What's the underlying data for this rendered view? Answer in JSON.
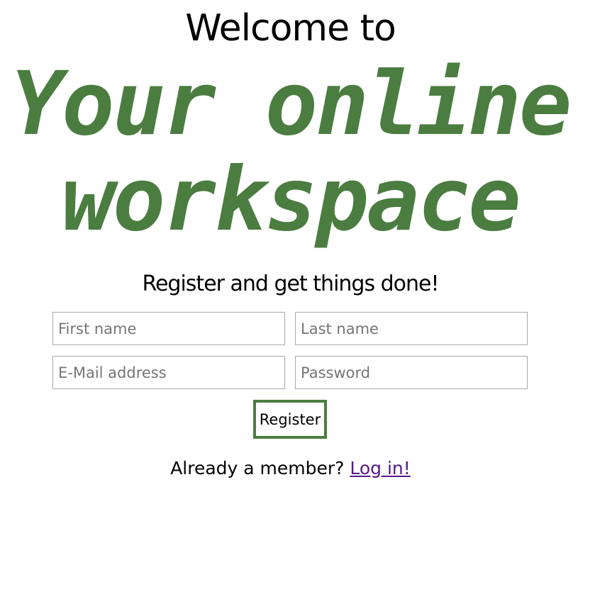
{
  "header": {
    "welcome": "Welcome to",
    "hero_line_1": "Your online",
    "hero_line_2": "workspace",
    "tagline": "Register and get things done!"
  },
  "form": {
    "first_name_placeholder": "First name",
    "last_name_placeholder": "Last name",
    "email_placeholder": "E-Mail address",
    "password_placeholder": "Password",
    "register_label": "Register"
  },
  "footer": {
    "member_text": "Already a member?",
    "login_link": "Log in!"
  },
  "colors": {
    "accent": "#4b7d41",
    "link": "#551a8b",
    "input_border": "#a9a9a9"
  }
}
